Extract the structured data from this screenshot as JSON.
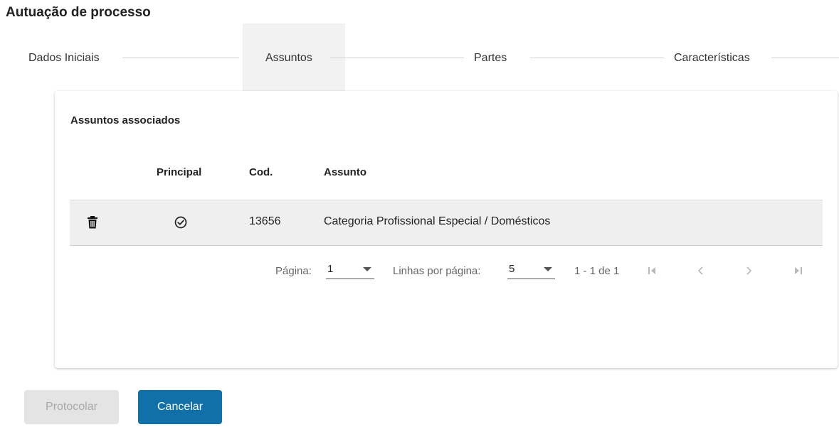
{
  "page": {
    "title": "Autuação de processo"
  },
  "stepper": {
    "steps": [
      {
        "label": "Dados Iniciais",
        "active": false
      },
      {
        "label": "Assuntos",
        "active": true
      },
      {
        "label": "Partes",
        "active": false
      },
      {
        "label": "Características",
        "active": false
      }
    ]
  },
  "section": {
    "title": "Assuntos associados"
  },
  "table": {
    "columns": [
      "",
      "Principal",
      "Cod.",
      "Assunto"
    ],
    "rows": [
      {
        "delete_icon": "trash-icon",
        "principal_icon": "check-circle-icon",
        "code": "13656",
        "subject": "Categoria Profissional Especial / Domésticos"
      }
    ]
  },
  "paginator": {
    "page_label": "Página:",
    "page_value": "1",
    "rows_label": "Linhas por página:",
    "rows_value": "5",
    "range_text": "1 - 1 de 1",
    "icons": [
      "first-page-icon",
      "previous-page-icon",
      "next-page-icon",
      "last-page-icon"
    ]
  },
  "actions": {
    "protocolar_label": "Protocolar",
    "cancelar_label": "Cancelar"
  },
  "colors": {
    "primary": "#1170a8",
    "active_step_bg": "#f2f2f2",
    "row_bg": "#efefef",
    "disabled_bg": "#e4e4e4",
    "disabled_text": "#a8a8a8",
    "icon_disabled": "#b8b8b8"
  }
}
